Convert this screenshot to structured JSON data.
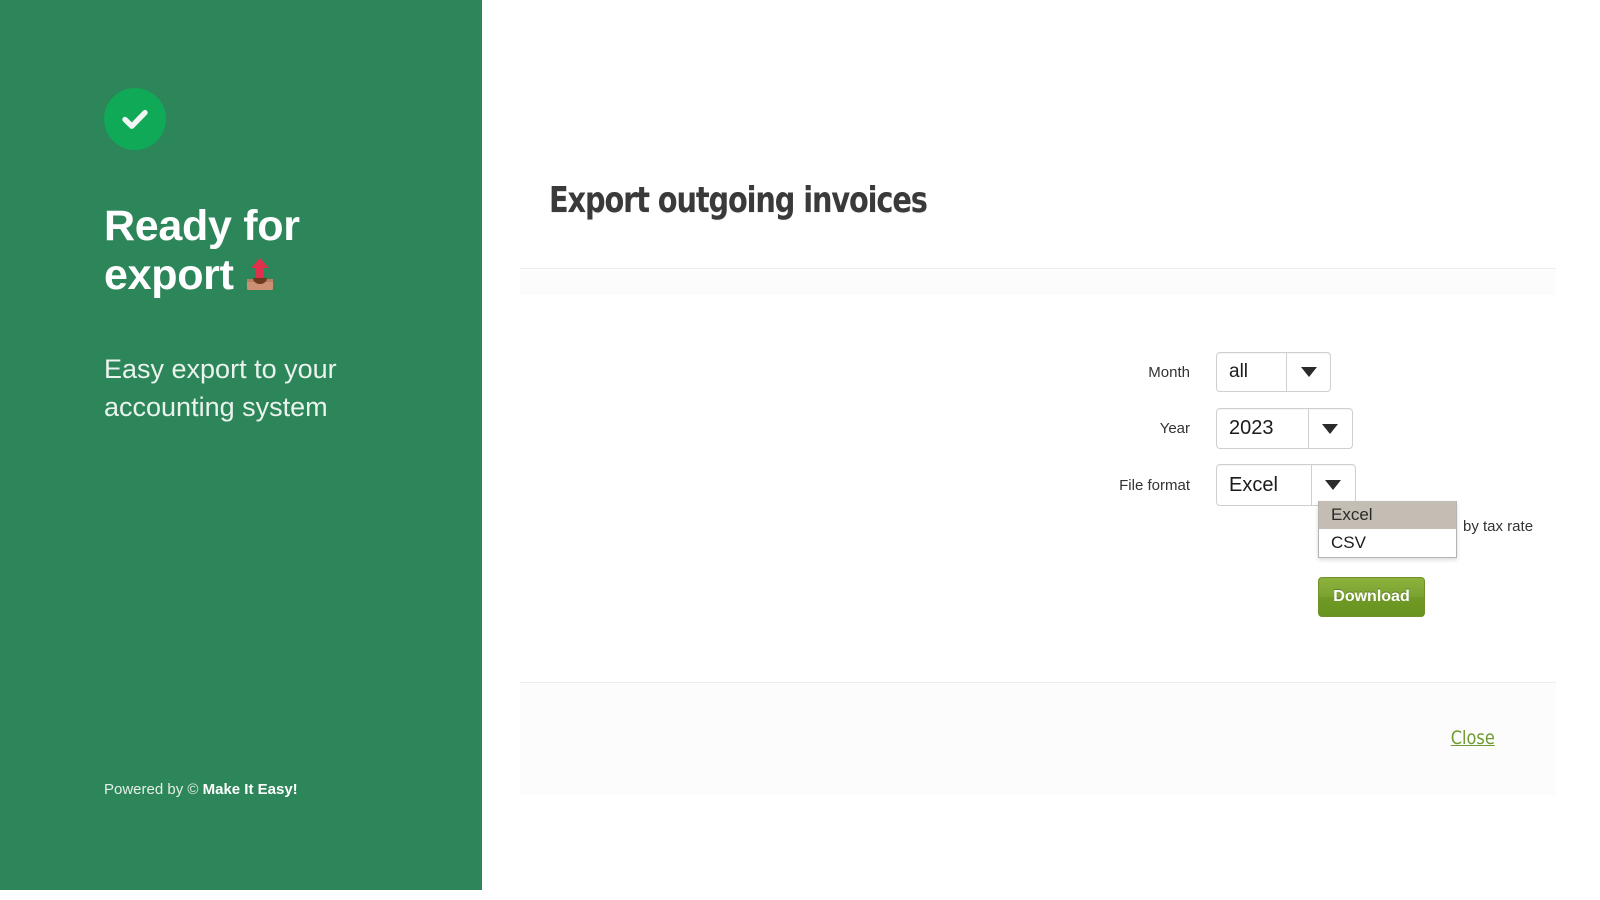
{
  "promo": {
    "check_icon": "check-circle-icon",
    "title_line1": "Ready for",
    "title_line2": "export",
    "title_emoji": "outbox-tray-emoji",
    "subtitle": "Easy export to your accounting system",
    "footer_prefix": "Powered by © ",
    "footer_brand": "Make It Easy!",
    "background_color": "#2d8659",
    "badge_color": "#0fa958"
  },
  "modal": {
    "title": "Export outgoing invoices",
    "form": {
      "month": {
        "label": "Month",
        "value": "all",
        "caret_icon": "chevron-down-icon"
      },
      "year": {
        "label": "Year",
        "value": "2023",
        "caret_icon": "chevron-down-icon"
      },
      "file_format": {
        "label": "File format",
        "value": "Excel",
        "caret_icon": "chevron-down-icon",
        "options": [
          {
            "label": "Excel",
            "selected": true
          },
          {
            "label": "CSV",
            "selected": false
          }
        ]
      },
      "tax_note": "by tax rate"
    },
    "download_button": "Download",
    "close_link": "Close",
    "accent_color": "#6f9a30"
  }
}
